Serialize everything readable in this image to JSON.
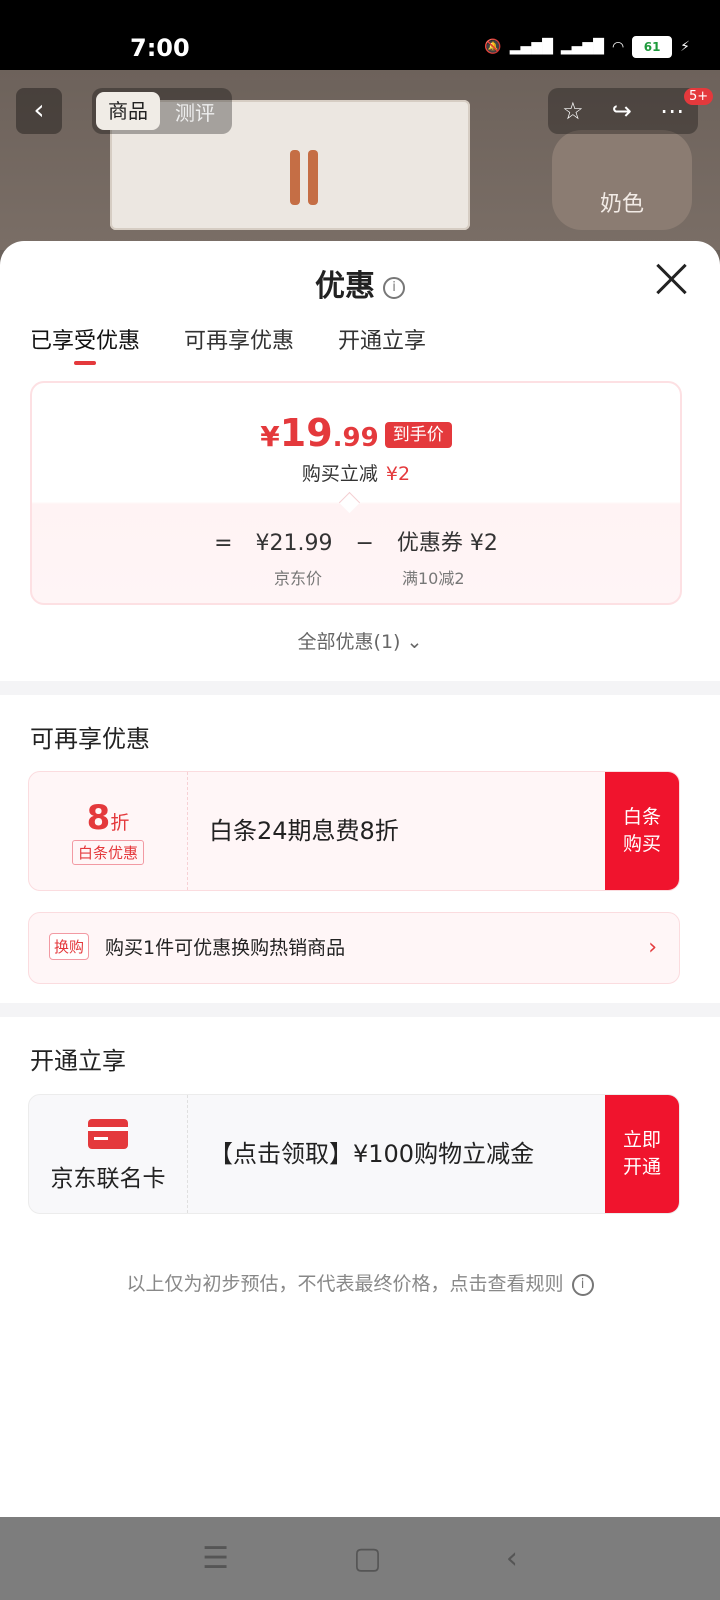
{
  "status_bar": {
    "time": "7:00",
    "battery": "61"
  },
  "background": {
    "tabs": [
      "商品",
      "测评"
    ],
    "color_label": "奶色",
    "badge": "5+"
  },
  "sheet": {
    "title": "优惠",
    "tabs": [
      "已享受优惠",
      "可再享优惠",
      "开通立享"
    ],
    "price": {
      "yen": "¥",
      "integer": "19",
      "decimal": ".99",
      "tag": "到手价",
      "reduce_label": "购买立减",
      "reduce_value": "¥2",
      "equals": "=",
      "jd_price": "¥21.99",
      "minus": "−",
      "coupon": "优惠券 ¥2",
      "jd_price_label": "京东价",
      "coupon_label": "满10减2"
    },
    "all_discounts": "全部优惠(1)",
    "more_section": {
      "title": "可再享优惠",
      "baitiao": {
        "num": "8",
        "unit": "折",
        "tag": "白条优惠",
        "text": "白条24期息费8折",
        "btn": "白条购买"
      },
      "swap": {
        "tag": "换购",
        "text": "购买1件可优惠换购热销商品",
        "arrow": "›"
      }
    },
    "open_section": {
      "title": "开通立享",
      "card_name": "京东联名卡",
      "text": "【点击领取】¥100购物立减金",
      "btn": "立即开通"
    },
    "footnote": "以上仅为初步预估，不代表最终价格，点击查看规则"
  }
}
